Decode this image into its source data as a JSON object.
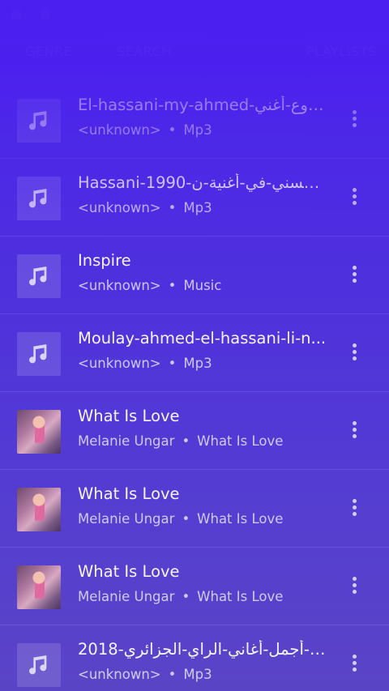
{
  "tabs": [
    {
      "label": "GENRE"
    },
    {
      "label": "SEARCH"
    },
    {
      "label": "PLAYLISTS"
    }
  ],
  "songs": [
    {
      "title": "El-hassani-my-ahmed-روع-أغني...",
      "artist": "<unknown>",
      "album": "Mp3",
      "thumb": "music-note-icon"
    },
    {
      "title": "Hassani-1990-لحسني-في-أغنية-ن...",
      "artist": "<unknown>",
      "album": "Mp3",
      "thumb": "music-note-icon"
    },
    {
      "title": "Inspire",
      "artist": "<unknown>",
      "album": "Music",
      "thumb": "music-note-icon"
    },
    {
      "title": "Moulay-ahmed-el-hassani-li-n...",
      "artist": "<unknown>",
      "album": "Mp3",
      "thumb": "music-note-icon"
    },
    {
      "title": "What Is Love",
      "artist": "Melanie Ungar",
      "album": "What Is Love",
      "thumb": "album-art"
    },
    {
      "title": "What Is Love",
      "artist": "Melanie Ungar",
      "album": "What Is Love",
      "thumb": "album-art"
    },
    {
      "title": "What Is Love",
      "artist": "Melanie Ungar",
      "album": "What Is Love",
      "thumb": "album-art"
    },
    {
      "title": "أجمل-أغاني-الراي-الجزائري-2018-...ch",
      "artist": "<unknown>",
      "album": "Mp3",
      "thumb": "music-note-icon"
    }
  ],
  "separator": "•",
  "colors": {
    "accent": "#4b1ff0",
    "bottom": "#5a44c6"
  }
}
